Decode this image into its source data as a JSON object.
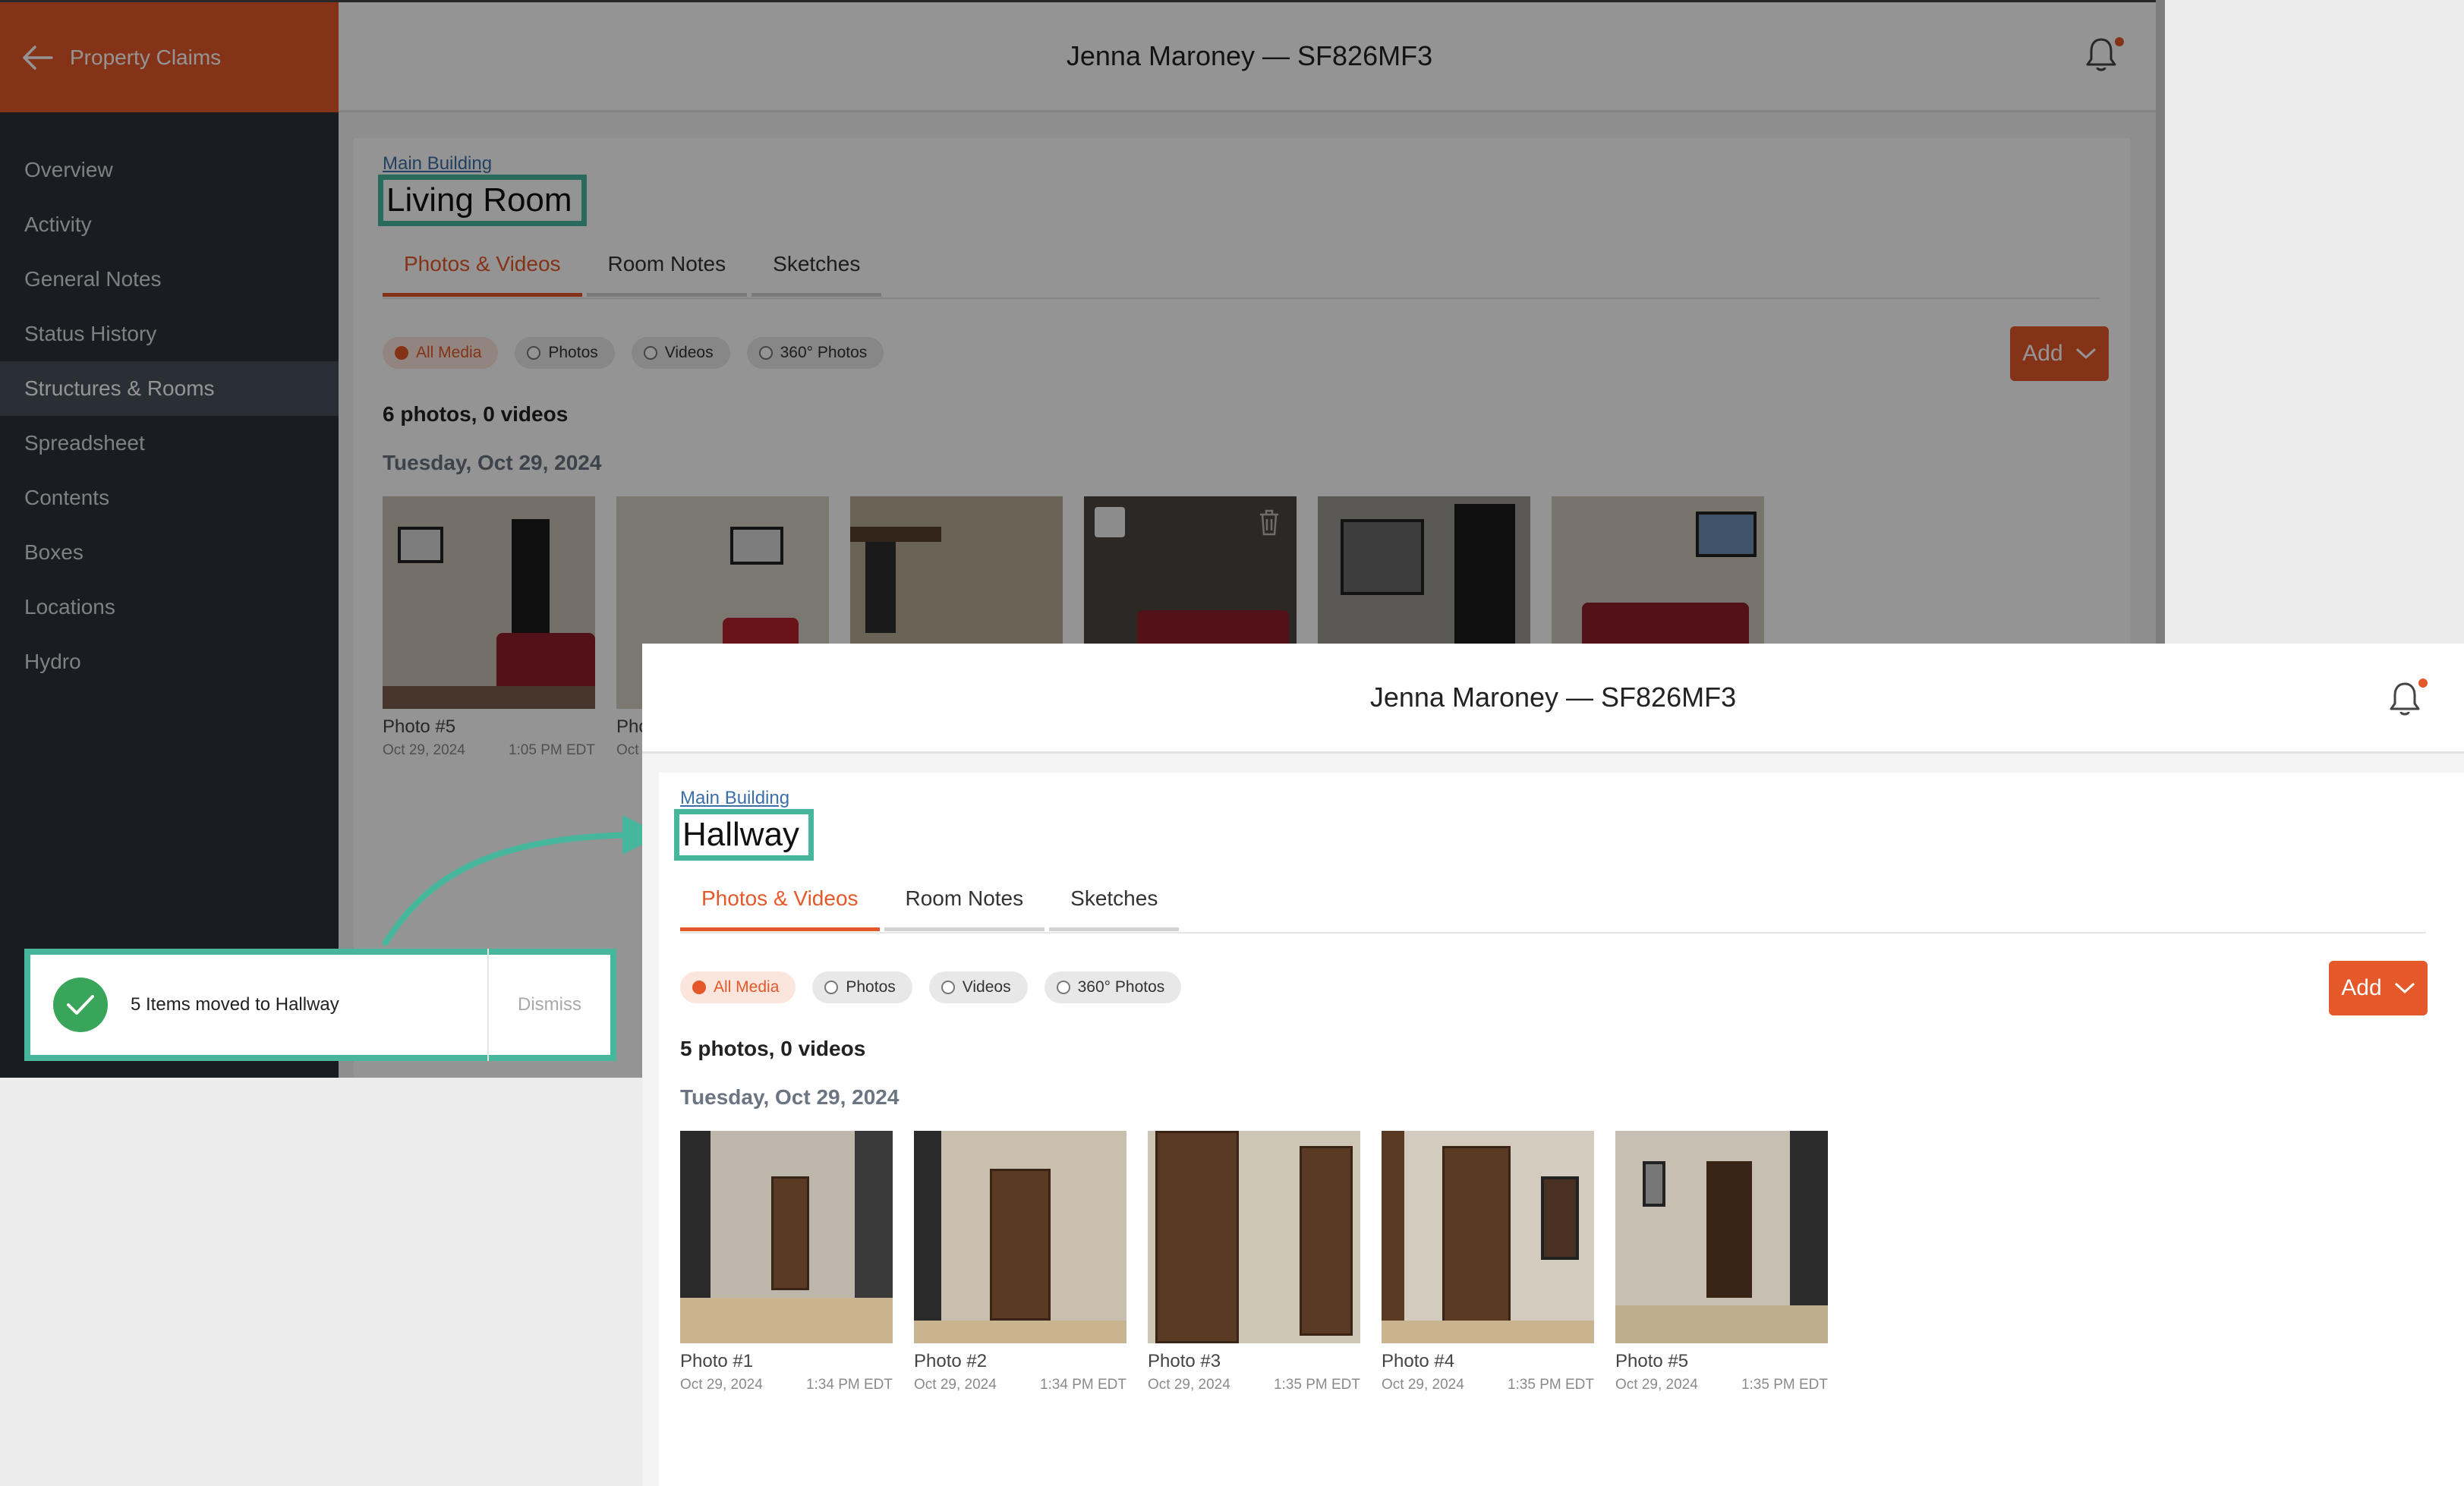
{
  "sidebar": {
    "back_label": "Property Claims",
    "items": [
      {
        "label": "Overview"
      },
      {
        "label": "Activity"
      },
      {
        "label": "General Notes"
      },
      {
        "label": "Status History"
      },
      {
        "label": "Structures & Rooms",
        "active": true
      },
      {
        "label": "Spreadsheet"
      },
      {
        "label": "Contents"
      },
      {
        "label": "Boxes"
      },
      {
        "label": "Locations"
      },
      {
        "label": "Hydro"
      }
    ]
  },
  "claim_title": "Jenna Maroney — SF826MF3",
  "tabs": [
    "Photos & Videos",
    "Room Notes",
    "Sketches"
  ],
  "filters": [
    "All Media",
    "Photos",
    "Videos",
    "360° Photos"
  ],
  "add_label": "Add",
  "background_room": {
    "breadcrumb": "Main Building",
    "title": "Living Room",
    "count": "6 photos, 0 videos",
    "date": "Tuesday, Oct 29, 2024",
    "photos": [
      {
        "name": "Photo #5",
        "date": "Oct 29, 2024",
        "time": "1:05 PM EDT"
      },
      {
        "name": "Pho",
        "date": "Oct",
        "time": ""
      }
    ]
  },
  "foreground_room": {
    "breadcrumb": "Main Building",
    "title": "Hallway",
    "count": "5 photos, 0 videos",
    "date": "Tuesday, Oct 29, 2024",
    "photos": [
      {
        "name": "Photo #1",
        "date": "Oct 29, 2024",
        "time": "1:34 PM EDT"
      },
      {
        "name": "Photo #2",
        "date": "Oct 29, 2024",
        "time": "1:34 PM EDT"
      },
      {
        "name": "Photo #3",
        "date": "Oct 29, 2024",
        "time": "1:35 PM EDT"
      },
      {
        "name": "Photo #4",
        "date": "Oct 29, 2024",
        "time": "1:35 PM EDT"
      },
      {
        "name": "Photo #5",
        "date": "Oct 29, 2024",
        "time": "1:35 PM EDT"
      }
    ]
  },
  "toast": {
    "message": "5 Items moved to Hallway",
    "dismiss_label": "Dismiss"
  },
  "colors": {
    "brand": "#e5582a",
    "highlight": "#46b79d",
    "success": "#39a55a",
    "sidebar": "#2b3138"
  }
}
